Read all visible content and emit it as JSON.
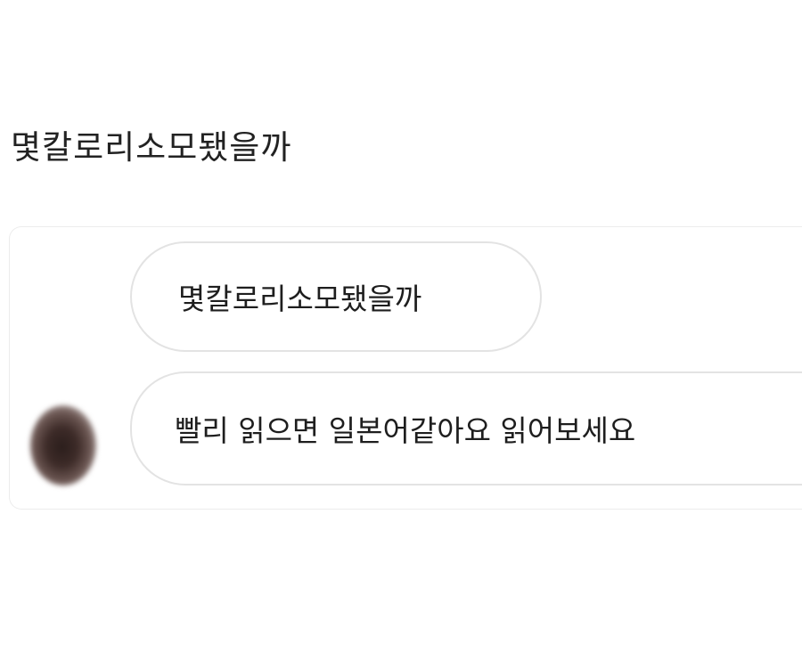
{
  "post": {
    "title": "몇칼로리소모됐을까"
  },
  "chat": {
    "messages": [
      {
        "text": "몇칼로리소모됐을까"
      },
      {
        "text": "빨리 읽으면 일본어같아요 읽어보세요"
      }
    ]
  },
  "colors": {
    "background": "#ffffff",
    "bubble_border": "#e3e3e3",
    "text": "#1e1e1e"
  }
}
